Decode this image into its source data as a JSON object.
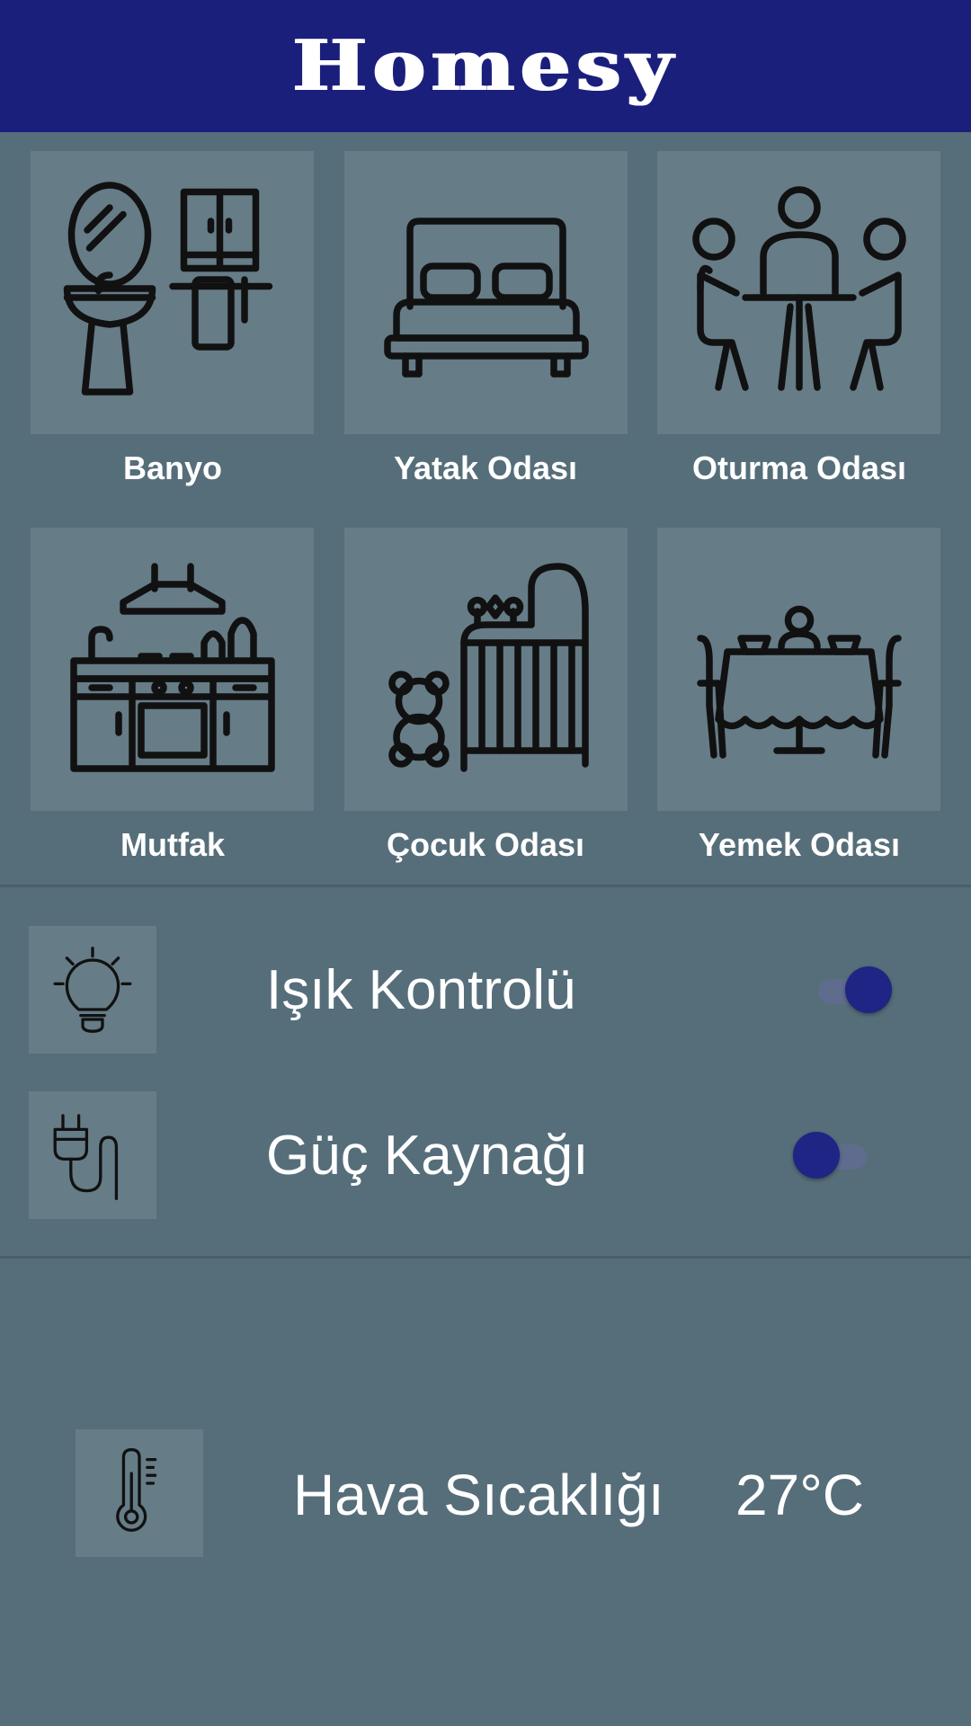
{
  "app": {
    "title": "Homesy"
  },
  "rooms": [
    {
      "label": "Banyo",
      "icon": "bathroom-icon"
    },
    {
      "label": "Yatak Odası",
      "icon": "bed-icon"
    },
    {
      "label": "Oturma Odası",
      "icon": "living-room-icon"
    },
    {
      "label": "Mutfak",
      "icon": "kitchen-icon"
    },
    {
      "label": "Çocuk Odası",
      "icon": "nursery-icon"
    },
    {
      "label": "Yemek Odası",
      "icon": "dining-room-icon"
    }
  ],
  "controls": [
    {
      "label": "Işık Kontrolü",
      "icon": "light-bulb-icon",
      "enabled": true
    },
    {
      "label": "Güç Kaynağı",
      "icon": "power-plug-icon",
      "enabled": false
    }
  ],
  "weather": {
    "label": "Hava Sıcaklığı",
    "value": "27°C",
    "icon": "thermometer-icon"
  },
  "colors": {
    "header": "#1b1f7c",
    "background": "#566e7a",
    "tile": "#667c87",
    "toggle_knob": "#1e2584"
  }
}
